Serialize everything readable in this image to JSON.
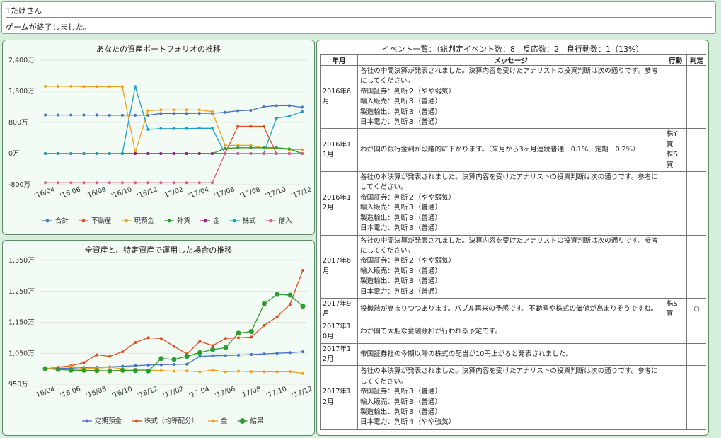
{
  "header": {
    "user_name": "1たけさん",
    "status_message": "ゲームが終了しました。"
  },
  "chart_data": [
    {
      "type": "line",
      "title": "あなたの資産ポートフォリオの推移",
      "x": [
        "'16/04",
        "'16/05",
        "'16/06",
        "'16/07",
        "'16/08",
        "'16/09",
        "'16/10",
        "'16/11",
        "'16/12",
        "'17/01",
        "'17/02",
        "'17/03",
        "'17/04",
        "'17/05",
        "'17/06",
        "'17/07",
        "'17/08",
        "'17/09",
        "'17/10",
        "'17/11",
        "'17/12"
      ],
      "x_tick_labels": [
        "'16/04",
        "'16/06",
        "'16/08",
        "'16/10",
        "'16/12",
        "'17/02",
        "'17/04",
        "'17/06",
        "'17/08",
        "'17/10",
        "'17/12"
      ],
      "y_tick_labels": [
        "2,400万",
        "1,600万",
        "800万",
        "0万",
        "-800万"
      ],
      "ylim": [
        -800,
        2400
      ],
      "yticks": [
        2400,
        1600,
        800,
        0,
        -800
      ],
      "grid": true,
      "legend_position": "bottom",
      "series": [
        {
          "name": "合計",
          "color": "#4472c4",
          "values": [
            990,
            990,
            990,
            990,
            990,
            985,
            985,
            985,
            985,
            1030,
            1030,
            1030,
            1035,
            1035,
            1060,
            1100,
            1110,
            1200,
            1230,
            1230,
            1190
          ]
        },
        {
          "name": "不動産",
          "color": "#dd4b1f",
          "values": [
            0,
            0,
            0,
            0,
            0,
            0,
            0,
            0,
            0,
            0,
            0,
            0,
            0,
            0,
            0,
            700,
            700,
            700,
            0,
            0,
            0
          ]
        },
        {
          "name": "現預金",
          "color": "#f0a020",
          "values": [
            1730,
            1730,
            1730,
            1720,
            1720,
            1720,
            1720,
            30,
            1100,
            1120,
            1120,
            1120,
            1120,
            1080,
            210,
            210,
            210,
            140,
            140,
            100,
            100
          ]
        },
        {
          "name": "外貨",
          "color": "#2d9b2d",
          "values": [
            0,
            0,
            0,
            0,
            0,
            0,
            0,
            0,
            0,
            0,
            0,
            0,
            0,
            0,
            130,
            150,
            150,
            150,
            150,
            120,
            0
          ]
        },
        {
          "name": "金",
          "color": "#9b1d8e",
          "values": [
            0,
            0,
            0,
            0,
            0,
            0,
            0,
            0,
            0,
            0,
            0,
            0,
            0,
            0,
            0,
            0,
            0,
            0,
            0,
            0,
            0
          ]
        },
        {
          "name": "株式",
          "color": "#1f9ec4",
          "values": [
            0,
            0,
            0,
            0,
            0,
            0,
            0,
            1720,
            620,
            640,
            640,
            640,
            650,
            650,
            0,
            0,
            0,
            0,
            910,
            960,
            1080
          ]
        },
        {
          "name": "借入",
          "color": "#e05b8f",
          "values": [
            -750,
            -750,
            -750,
            -750,
            -750,
            -750,
            -750,
            -750,
            -750,
            -750,
            -750,
            -750,
            -750,
            -750,
            0,
            0,
            0,
            0,
            0,
            0,
            0
          ]
        }
      ]
    },
    {
      "type": "line",
      "title": "全資産と、特定資産で運用した場合の推移",
      "x": [
        "'16/04",
        "'16/05",
        "'16/06",
        "'16/07",
        "'16/08",
        "'16/09",
        "'16/10",
        "'16/11",
        "'16/12",
        "'17/01",
        "'17/02",
        "'17/03",
        "'17/04",
        "'17/05",
        "'17/06",
        "'17/07",
        "'17/08",
        "'17/09",
        "'17/10",
        "'17/11",
        "'17/12"
      ],
      "x_tick_labels": [
        "'16/04",
        "'16/06",
        "'16/08",
        "'16/10",
        "'16/12",
        "'17/02",
        "'17/04",
        "'17/06",
        "'17/08",
        "'17/10",
        "'17/12"
      ],
      "y_tick_labels": [
        "1,350万",
        "1,250万",
        "1,150万",
        "1,050万",
        "950万"
      ],
      "ylim": [
        950,
        1350
      ],
      "yticks": [
        1350,
        1250,
        1150,
        1050,
        950
      ],
      "grid": true,
      "legend_position": "bottom",
      "series": [
        {
          "name": "定期預金",
          "color": "#4472c4",
          "marker": 4,
          "values": [
            1000,
            1001,
            1002,
            1004,
            1005,
            1006,
            1008,
            1010,
            1012,
            1013,
            1014,
            1015,
            1040,
            1042,
            1043,
            1044,
            1046,
            1048,
            1050,
            1052,
            1055
          ]
        },
        {
          "name": "株式（均等配分）",
          "color": "#dd4b1f",
          "marker": 4,
          "values": [
            1000,
            1005,
            1010,
            1020,
            1045,
            1040,
            1055,
            1085,
            1100,
            1098,
            1072,
            1048,
            1088,
            1075,
            1098,
            1100,
            1102,
            1140,
            1168,
            1208,
            1318
          ]
        },
        {
          "name": "金",
          "color": "#f0a020",
          "marker": 4,
          "values": [
            1000,
            1004,
            1008,
            1000,
            1002,
            1005,
            1000,
            998,
            996,
            994,
            992,
            993,
            990,
            996,
            990,
            992,
            991,
            990,
            990,
            991,
            985
          ]
        },
        {
          "name": "結果",
          "color": "#2d9b2d",
          "marker": 7,
          "values": [
            1000,
            998,
            995,
            995,
            994,
            993,
            995,
            994,
            993,
            1033,
            1030,
            1040,
            1052,
            1062,
            1068,
            1115,
            1120,
            1210,
            1240,
            1238,
            1202
          ]
        }
      ]
    }
  ],
  "events": {
    "title": "イベント一覧：（総判定イベント数：8　反応数：2　良行動数：1（13%）",
    "columns": [
      "年月",
      "メッセージ",
      "行動",
      "判定"
    ],
    "rows": [
      {
        "date": "2016年6月",
        "message": "各社の中間決算が発表されました。決算内容を受けたアナリストの投資判断は次の通りです。参考にしてください。\n帝国証券：判断２（やや弱気）\n輸入販売：判断３（普通）\n製造輸出：判断３（普通）\n日本電力：判断３（普通）",
        "action": "",
        "judgement": ""
      },
      {
        "date": "2016年11月",
        "message": "わが国の銀行金利が段階的に下がります。（来月から3ヶ月連続普通－0.1%、定期－0.2%）",
        "action": "株Y買\n株S買",
        "judgement": ""
      },
      {
        "date": "2016年12月",
        "message": "各社の本決算が発表されました。決算内容を受けたアナリストの投資判断は次の通りです。参考にしてください。\n帝国証券：判断２（やや弱気）\n輸入販売：判断３（普通）\n製造輸出：判断３（普通）\n日本電力：判断３（普通）",
        "action": "",
        "judgement": ""
      },
      {
        "date": "2017年6月",
        "message": "各社の中間決算が発表されました。決算内容を受けたアナリストの投資判断は次の通りです。参考にしてください。\n帝国証券：判断２（やや弱気）\n輸入販売：判断３（普通）\n製造輸出：判断３（普通）\n日本電力：判断３（普通）",
        "action": "",
        "judgement": ""
      },
      {
        "date": "2017年9月",
        "message": "投機熱が高まりつつあります。バブル再来の予感です。不動産や株式の価値が高まりそうですね。",
        "action": "株S買",
        "judgement": "○"
      },
      {
        "date": "2017年10月",
        "message": "わが国で大胆な金融緩和が行われる予定です。",
        "action": "",
        "judgement": ""
      },
      {
        "date": "2017年12月",
        "message": "帝国証券社の今期以降の株式の配当が10円上がると発表されました。",
        "action": "",
        "judgement": ""
      },
      {
        "date": "2017年12月",
        "message": "各社の本決算が発表されました。決算内容を受けたアナリストの投資判断は次の通りです。参考にしてください。\n帝国証券：判断３（普通）\n輸入販売：判断３（普通）\n製造輸出：判断３（普通）\n日本電力：判断４（やや強気）",
        "action": "",
        "judgement": ""
      }
    ]
  }
}
